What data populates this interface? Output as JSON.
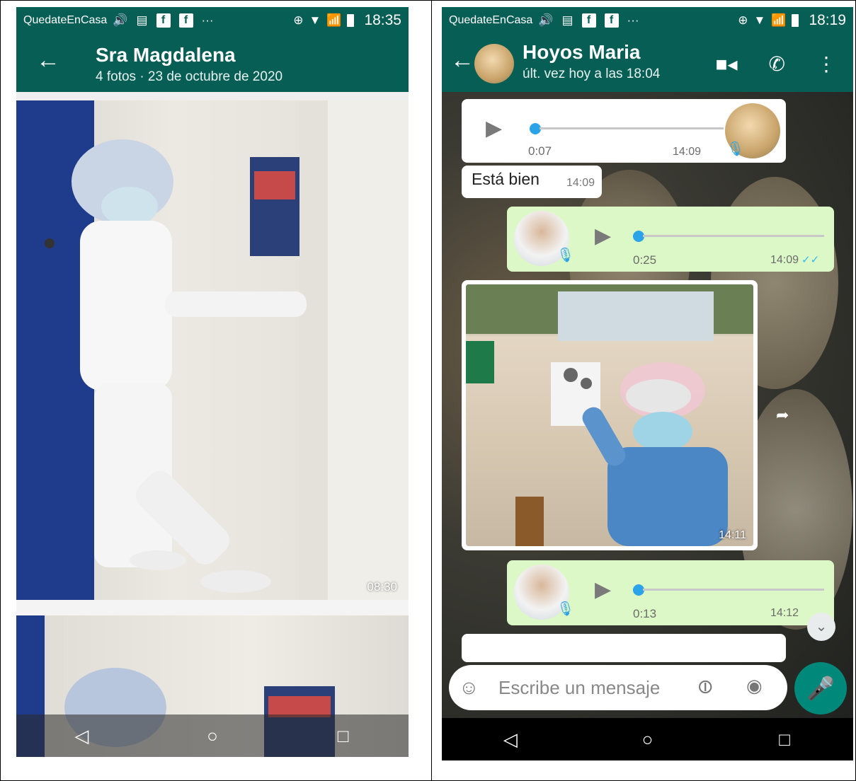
{
  "left": {
    "status": {
      "app": "QuedateEnCasa",
      "time": "18:35",
      "dots": "···"
    },
    "header": {
      "title": "Sra Magdalena",
      "subtitle": "4 fotos · 23 de octubre de 2020"
    },
    "photos": [
      {
        "time": "08:30"
      }
    ]
  },
  "right": {
    "status": {
      "app": "QuedateEnCasa",
      "time": "18:19",
      "dots": "···"
    },
    "header": {
      "title": "Hoyos Maria",
      "subtitle": "últ. vez hoy a las 18:04"
    },
    "messages": {
      "voice_in": {
        "duration": "0:07",
        "time": "14:09"
      },
      "text_in": {
        "text": "Está bien",
        "time": "14:09"
      },
      "voice_out_1": {
        "duration": "0:25",
        "time": "14:09"
      },
      "image_in": {
        "time": "14:11"
      },
      "voice_out_2": {
        "duration": "0:13",
        "time": "14:12"
      }
    },
    "composer": {
      "placeholder": "Escribe un mensaje"
    }
  },
  "colors": {
    "header": "#075e54",
    "outgoing": "#dcf8c6",
    "incoming": "#ffffff",
    "accent": "#00897b",
    "ticks": "#34b7f1"
  },
  "icons": [
    "back-arrow-icon",
    "video-call-icon",
    "phone-icon",
    "more-options-icon",
    "play-icon",
    "mic-icon",
    "emoji-icon",
    "attach-icon",
    "camera-icon",
    "forward-icon",
    "scroll-down-icon",
    "nav-back-icon",
    "nav-home-icon",
    "nav-recents-icon"
  ]
}
